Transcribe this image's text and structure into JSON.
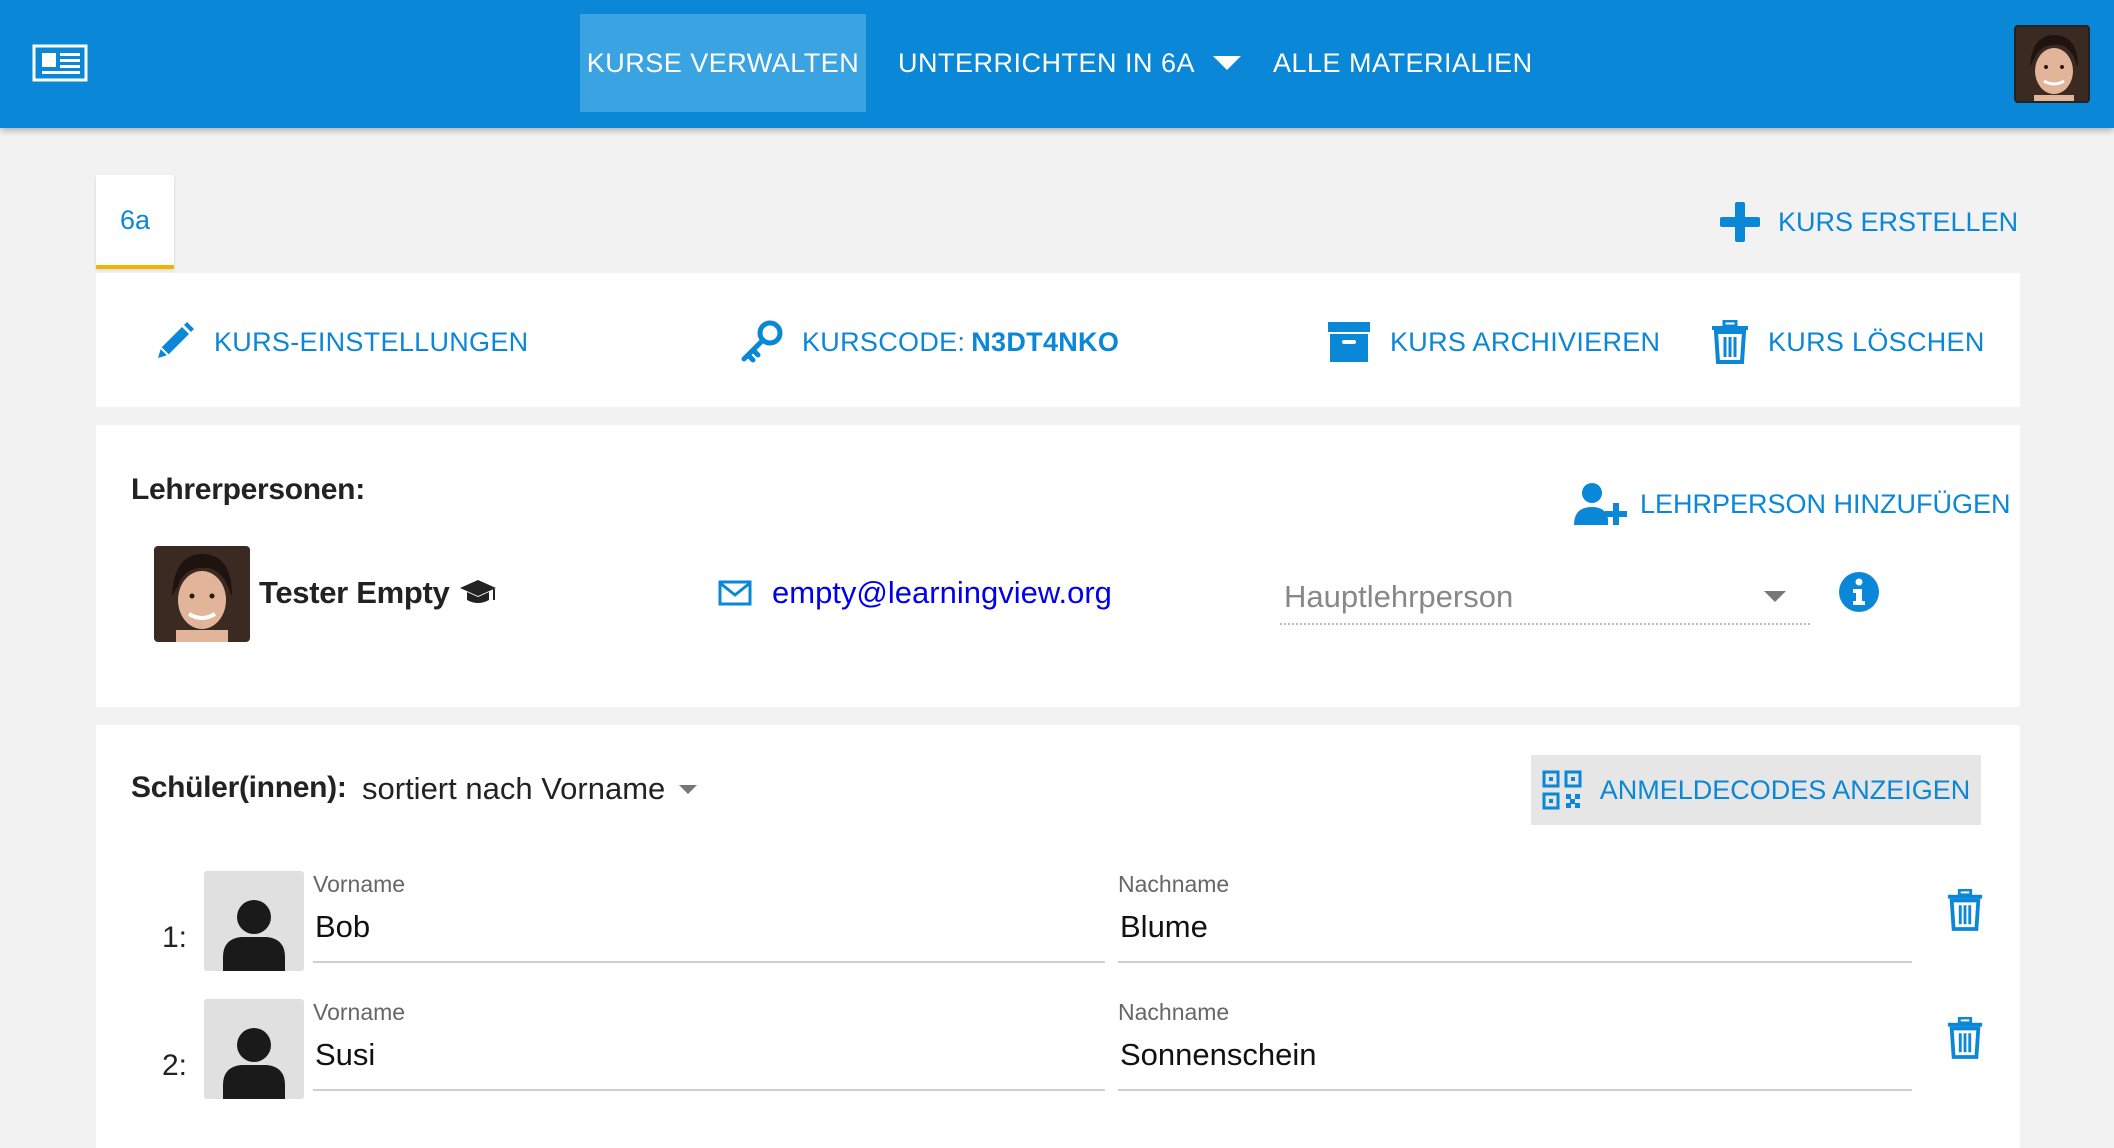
{
  "nav": {
    "manage": "KURSE VERWALTEN",
    "teach": "UNTERRICHTEN IN 6A",
    "all": "ALLE MATERIALIEN"
  },
  "tab": {
    "label": "6a"
  },
  "create_course": "KURS ERSTELLEN",
  "course_actions": {
    "settings": "KURS-EINSTELLUNGEN",
    "code_label": "KURSCODE:",
    "code_value": "N3DT4NKO",
    "archive": "KURS ARCHIVIEREN",
    "delete": "KURS LÖSCHEN"
  },
  "teachers": {
    "title": "Lehrerpersonen:",
    "add": "LEHRPERSON HINZUFÜGEN",
    "list": [
      {
        "name": "Tester Empty",
        "email": "empty@learningview.org",
        "role": "Hauptlehrperson"
      }
    ]
  },
  "students": {
    "title": "Schüler(innen):",
    "sort": "sortiert nach Vorname",
    "codes_button": "ANMELDECODES ANZEIGEN",
    "first_label": "Vorname",
    "last_label": "Nachname",
    "list": [
      {
        "num": "1:",
        "first": "Bob",
        "last": "Blume"
      },
      {
        "num": "2:",
        "first": "Susi",
        "last": "Sonnenschein"
      }
    ]
  },
  "colors": {
    "primary": "#0a87d6",
    "nav_active": "#3aa3e2",
    "tab_accent": "#f0b400",
    "link": "#0000ee"
  }
}
